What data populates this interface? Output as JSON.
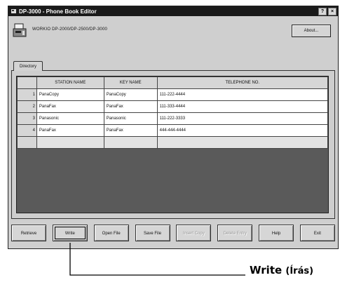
{
  "window": {
    "title": "DP-3000 - Phone Book Editor",
    "controls": {
      "help": "?",
      "close": "×"
    },
    "models": "WORKIO DP-2000/DP-2500/DP-3000",
    "about_label": "About..."
  },
  "tabs": [
    {
      "label": "Directory",
      "active": true
    }
  ],
  "table": {
    "columns": [
      "",
      "STATION NAME",
      "KEY NAME",
      "TELEPHONE NO."
    ],
    "rows": [
      {
        "num": "1",
        "station": "PanaCopy",
        "key": "PanaCopy",
        "phone": "111-222-4444"
      },
      {
        "num": "2",
        "station": "PanaFax",
        "key": "PanaFax",
        "phone": "111-333-4444"
      },
      {
        "num": "3",
        "station": "Panasonic",
        "key": "Panasonic",
        "phone": "111-222-3333"
      },
      {
        "num": "4",
        "station": "PanaFax",
        "key": "PanaFax",
        "phone": "444-444-4444"
      }
    ]
  },
  "buttons": {
    "retrieve": "Retrieve",
    "write": "Write",
    "open_file": "Open File",
    "save_file": "Save File",
    "insert_copy": "Insert Copy",
    "delete_entry": "Delete Entry",
    "help": "Help",
    "exit": "Exit"
  },
  "callout": {
    "label": "Write",
    "translation": "(Írás)"
  }
}
